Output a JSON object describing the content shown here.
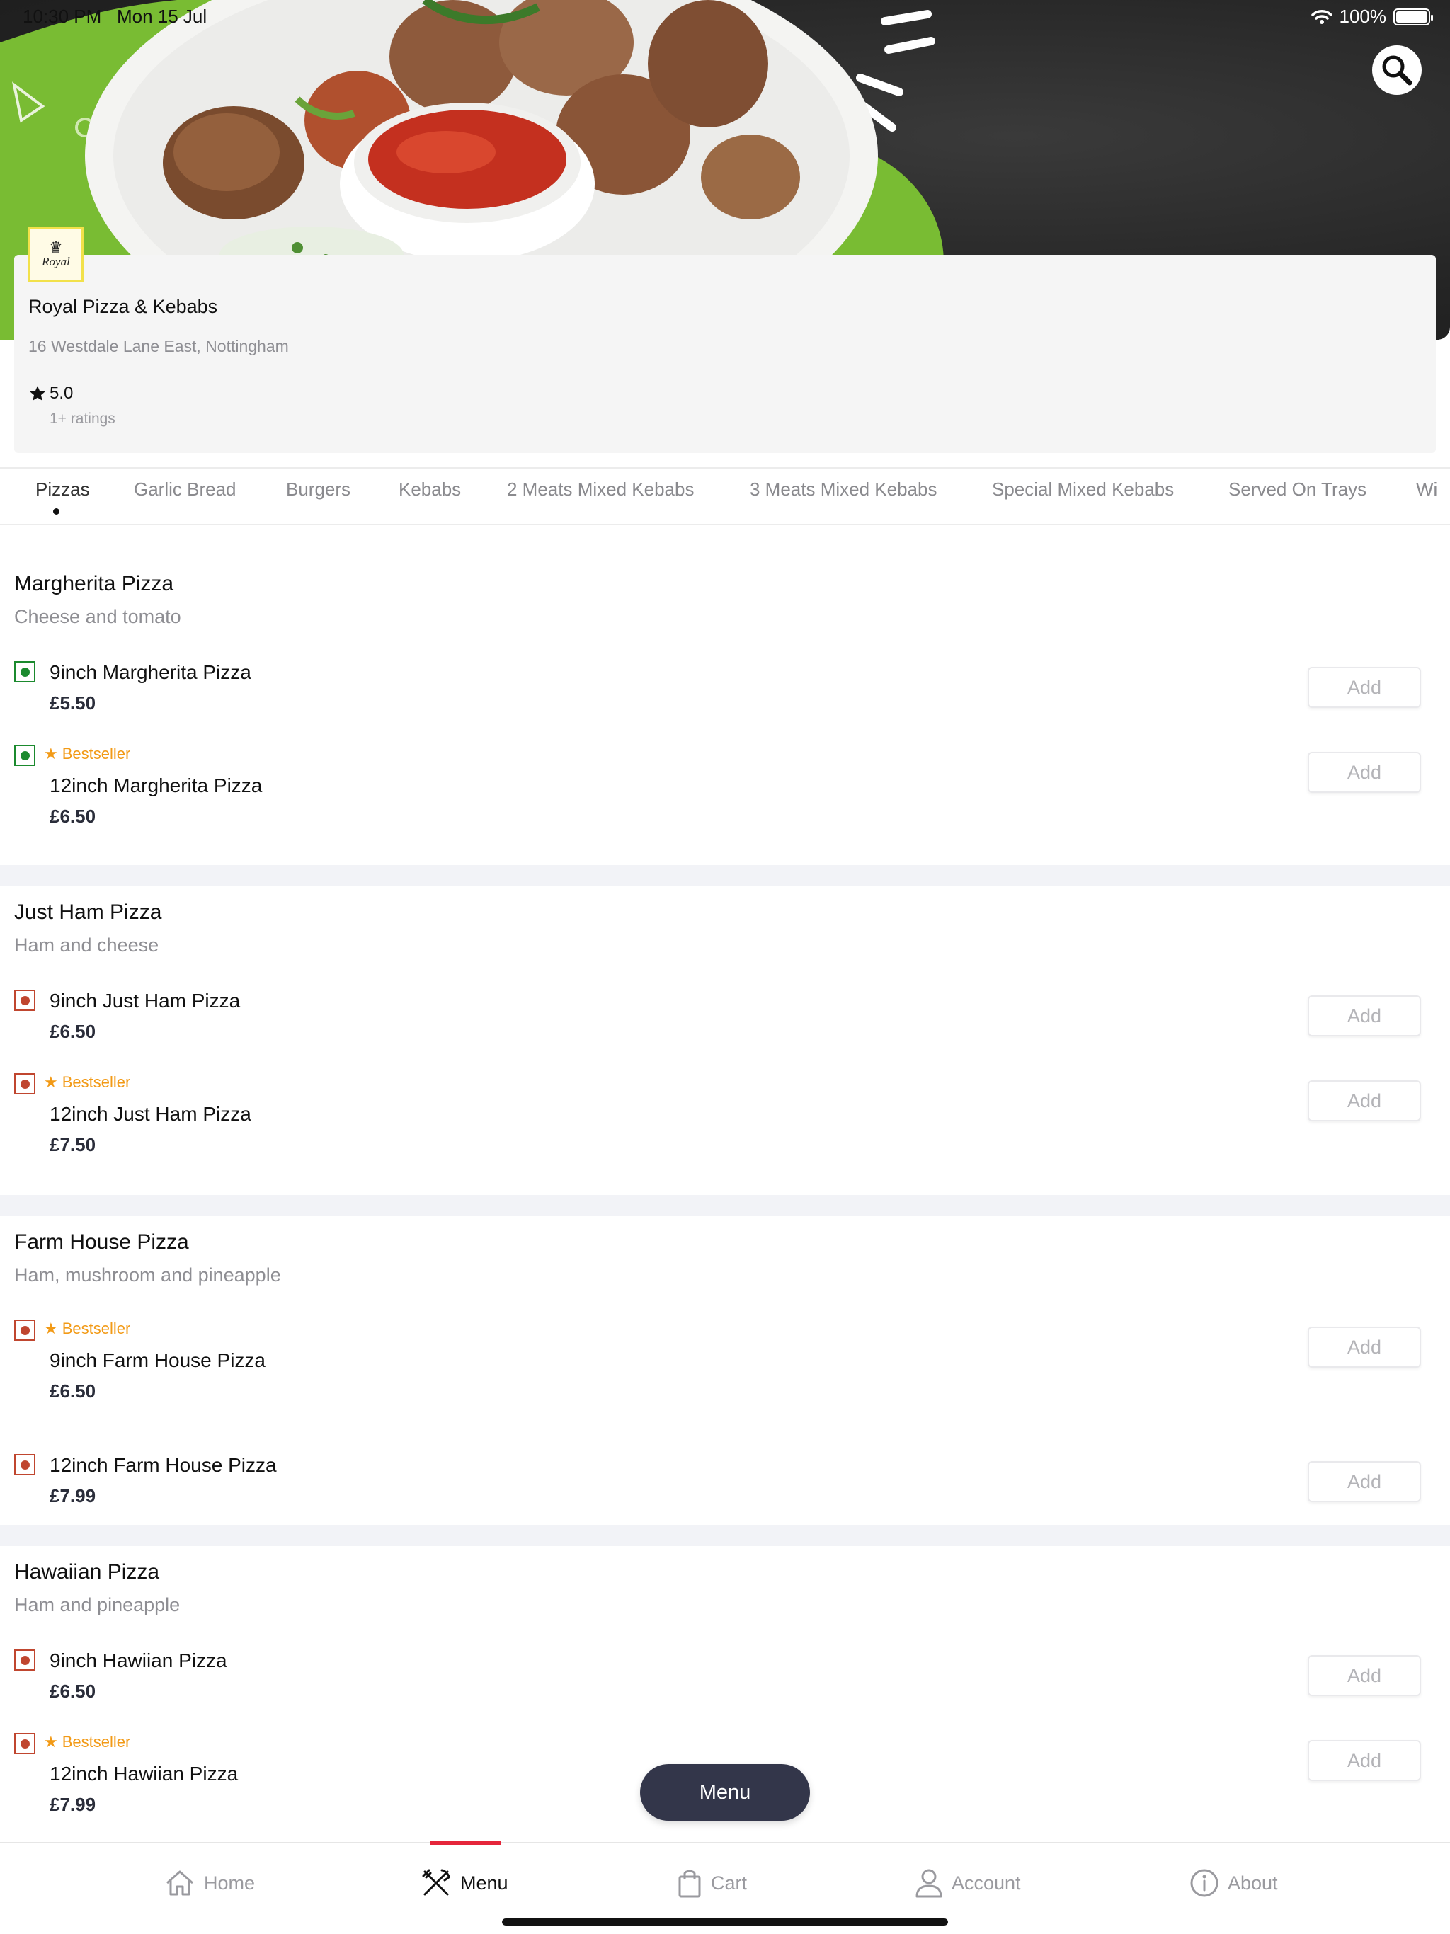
{
  "status_bar": {
    "time": "10:30 PM",
    "date": "Mon 15 Jul",
    "battery": "100%"
  },
  "restaurant": {
    "logo_text": "Royal",
    "name": "Royal Pizza & Kebabs",
    "address": "16 Westdale Lane East, Nottingham",
    "rating": "5.0",
    "ratings_count": "1+ ratings"
  },
  "categories": [
    "Pizzas",
    "Garlic Bread",
    "Burgers",
    "Kebabs",
    "2 Meats Mixed Kebabs",
    "3 Meats Mixed Kebabs",
    "Special Mixed Kebabs",
    "Served On Trays",
    "Wi"
  ],
  "active_category": "Pizzas",
  "sections": [
    {
      "title": "Margherita Pizza",
      "description": "Cheese and tomato",
      "items": [
        {
          "name": "9inch Margherita Pizza",
          "price": "£5.50",
          "bestseller": false,
          "type": "veg",
          "add": "Add"
        },
        {
          "name": "12inch Margherita Pizza",
          "price": "£6.50",
          "bestseller": true,
          "badge": "Bestseller",
          "type": "veg",
          "add": "Add"
        }
      ]
    },
    {
      "title": "Just Ham Pizza",
      "description": "Ham and cheese",
      "items": [
        {
          "name": "9inch Just Ham Pizza",
          "price": "£6.50",
          "bestseller": false,
          "type": "non-veg",
          "add": "Add"
        },
        {
          "name": "12inch Just Ham Pizza",
          "price": "£7.50",
          "bestseller": true,
          "badge": "Bestseller",
          "type": "non-veg",
          "add": "Add"
        }
      ]
    },
    {
      "title": "Farm House Pizza",
      "description": "Ham, mushroom and pineapple",
      "items": [
        {
          "name": "9inch Farm House Pizza",
          "price": "£6.50",
          "bestseller": true,
          "badge": "Bestseller",
          "type": "non-veg",
          "add": "Add"
        },
        {
          "name": "12inch Farm House Pizza",
          "price": "£7.99",
          "bestseller": false,
          "type": "non-veg",
          "add": "Add"
        }
      ]
    },
    {
      "title": "Hawaiian Pizza",
      "description": "Ham and pineapple",
      "items": [
        {
          "name": "9inch Hawiian Pizza",
          "price": "£6.50",
          "bestseller": false,
          "type": "non-veg",
          "add": "Add"
        },
        {
          "name": "12inch Hawiian Pizza",
          "price": "£7.99",
          "bestseller": true,
          "badge": "Bestseller",
          "type": "non-veg",
          "add": "Add"
        }
      ]
    }
  ],
  "menu_button": "Menu",
  "tab_bar": {
    "items": [
      {
        "label": "Home",
        "icon": "home-icon"
      },
      {
        "label": "Menu",
        "icon": "cutlery-icon",
        "active": true
      },
      {
        "label": "Cart",
        "icon": "bag-icon"
      },
      {
        "label": "Account",
        "icon": "person-icon"
      },
      {
        "label": "About",
        "icon": "info-icon"
      }
    ]
  },
  "colors": {
    "accent_red": "#e5253a",
    "veg_green": "#1b8a2e",
    "nonveg_red": "#c0462f",
    "bestseller_orange": "#f29a16",
    "menu_button": "#33364a"
  }
}
